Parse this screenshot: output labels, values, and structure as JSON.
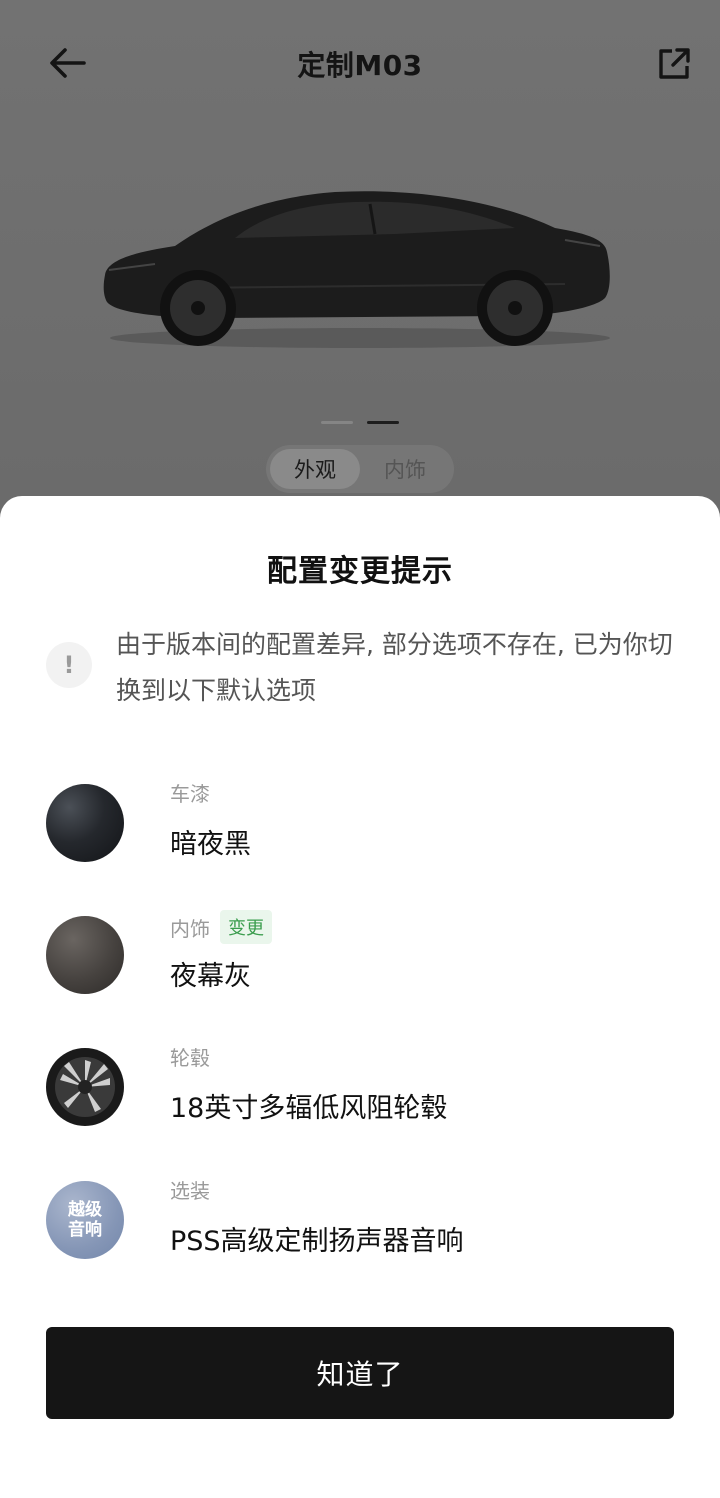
{
  "header": {
    "title": "定制M03"
  },
  "carousel": {
    "dot_count": 2,
    "active_index": 1
  },
  "view_toggle": {
    "options": [
      "外观",
      "内饰"
    ],
    "selected": "外观"
  },
  "dialog": {
    "title": "配置变更提示",
    "notice_icon": "!",
    "notice_text": "由于版本间的配置差异, 部分选项不存在, 已为你切换到以下默认选项",
    "options": [
      {
        "category": "车漆",
        "value": "暗夜黑",
        "badge": "",
        "swatch": "paint"
      },
      {
        "category": "内饰",
        "value": "夜幕灰",
        "badge": "变更",
        "swatch": "interior"
      },
      {
        "category": "轮毂",
        "value": "18英寸多辐低风阻轮毂",
        "badge": "",
        "swatch": "wheel"
      },
      {
        "category": "选装",
        "value": "PSS高级定制扬声器音响",
        "badge": "",
        "swatch": "audio",
        "swatch_text_1": "越级",
        "swatch_text_2": "音响"
      }
    ],
    "confirm_label": "知道了"
  },
  "colors": {
    "overlay_bg": "#6f6f6f",
    "sheet_bg": "#ffffff",
    "button_bg": "#151515",
    "badge_bg": "#eaf6ec",
    "badge_text": "#3b9d4e"
  }
}
